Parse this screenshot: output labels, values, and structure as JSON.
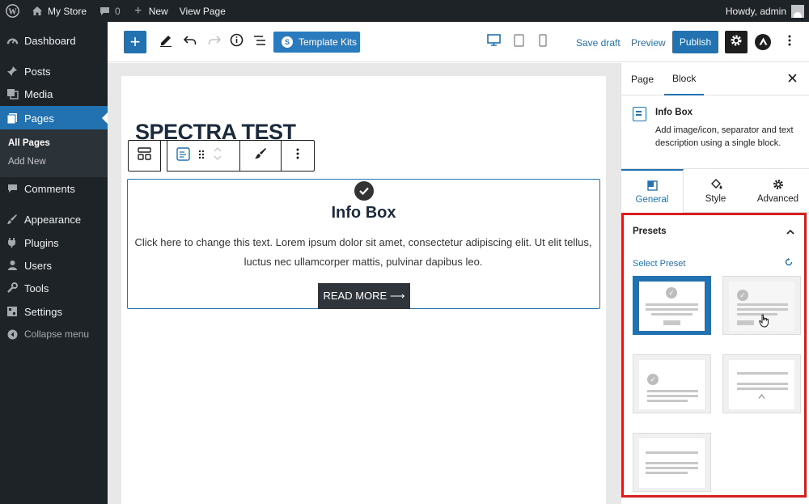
{
  "adminbar": {
    "site_name": "My Store",
    "comments_count": "0",
    "new_label": "New",
    "view_page_label": "View Page",
    "howdy_label": "Howdy, admin"
  },
  "sidebar": {
    "items": [
      {
        "label": "Dashboard",
        "icon": "dashboard-icon"
      },
      {
        "label": "Posts",
        "icon": "pin-icon"
      },
      {
        "label": "Media",
        "icon": "media-icon"
      },
      {
        "label": "Pages",
        "icon": "pages-icon"
      },
      {
        "label": "Comments",
        "icon": "comment-icon"
      },
      {
        "label": "Appearance",
        "icon": "brush-icon"
      },
      {
        "label": "Plugins",
        "icon": "plug-icon"
      },
      {
        "label": "Users",
        "icon": "user-icon"
      },
      {
        "label": "Tools",
        "icon": "wrench-icon"
      },
      {
        "label": "Settings",
        "icon": "settings-icon"
      }
    ],
    "submenu": [
      "All Pages",
      "Add New"
    ],
    "collapse_label": "Collapse menu"
  },
  "toolbar": {
    "template_kits_label": "Template Kits",
    "save_draft_label": "Save draft",
    "preview_label": "Preview",
    "publish_label": "Publish"
  },
  "editor": {
    "page_title": "SPECTRA TEST",
    "infobox": {
      "title": "Info Box",
      "text": "Click here to change this text. Lorem ipsum dolor sit amet, consectetur adipiscing elit. Ut elit tellus, luctus nec ullamcorper mattis, pulvinar dapibus leo.",
      "button_label": "READ MORE ⟶"
    }
  },
  "panel": {
    "tabs": [
      "Page",
      "Block"
    ],
    "block_name": "Info Box",
    "block_description": "Add image/icon, separator and text description using a single block.",
    "inner_tabs": [
      "General",
      "Style",
      "Advanced"
    ],
    "presets_heading": "Presets",
    "select_preset_label": "Select Preset"
  },
  "colors": {
    "accent": "#2271b1",
    "admin_dark": "#1d2327",
    "highlight_border": "#d61f1f"
  }
}
